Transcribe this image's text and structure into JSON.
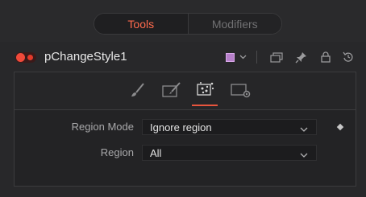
{
  "top_tabs": {
    "tools": "Tools",
    "modifiers": "Modifiers"
  },
  "node": {
    "name": "pChangeStyle1",
    "color_swatch": "#b67fc9"
  },
  "icons": {
    "tools_tab": [
      "brush-icon",
      "paint-icon",
      "particle-icon",
      "settings-panel-icon"
    ],
    "header": [
      "color-swatch-icon",
      "chevron-down-icon",
      "collapse-icon",
      "pin-icon",
      "lock-icon",
      "reset-icon"
    ]
  },
  "colors": {
    "accent": "#e8553d",
    "background": "#28282a",
    "panel": "#232325"
  },
  "controls": {
    "region_mode": {
      "label": "Region Mode",
      "value": "Ignore region"
    },
    "region": {
      "label": "Region",
      "value": "All"
    }
  }
}
